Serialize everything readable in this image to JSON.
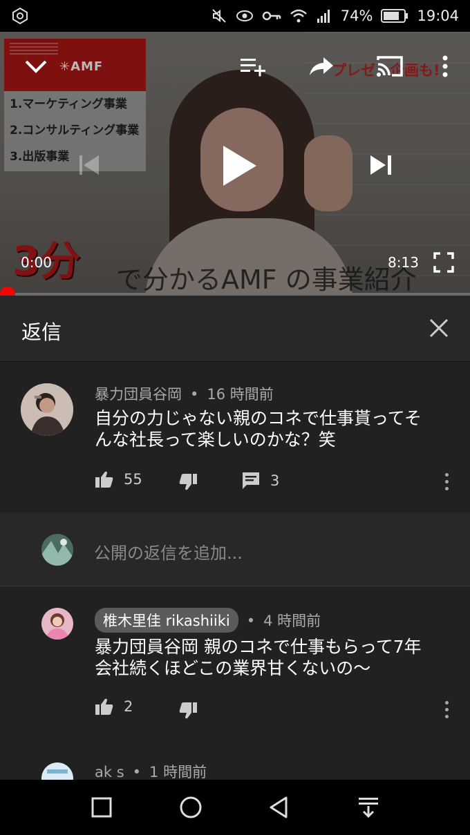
{
  "status_bar": {
    "battery": "74%",
    "time": "19:04",
    "icons": [
      "app-sync-icon",
      "mute-icon",
      "eye-icon",
      "key-icon",
      "wifi-icon",
      "signal-icon",
      "battery-icon"
    ]
  },
  "video": {
    "brand": "✳AMF",
    "menu_items": [
      "1.マーケティング事業",
      "2.コンサルティング事業",
      "3.出版事業"
    ],
    "overlay_red_text": "プレゼ　企画も!",
    "caption_big": "3分",
    "caption_rest": "で分かるAMF の事業紹介",
    "current_time": "0:00",
    "duration": "8:13",
    "progress_fraction": 0.0,
    "controls": [
      "collapse-icon",
      "add-to-queue-icon",
      "share-icon",
      "cast-icon",
      "more-icon",
      "previous-icon",
      "play-icon",
      "next-icon",
      "fullscreen-icon"
    ]
  },
  "replies_panel": {
    "title": "返信",
    "close_icon": "close-icon"
  },
  "main_comment": {
    "author": "暴力団員谷岡",
    "time_ago": "16 時間前",
    "text_line1": "自分の力じゃない親のコネで仕事貰ってそ",
    "text_line2": "んな社長って楽しいのかな？笑",
    "likes": "55",
    "replies": "3"
  },
  "reply_input": {
    "placeholder": "公開の返信を追加..."
  },
  "replies": [
    {
      "author": "椎木里佳 rikashiiki",
      "time_ago": "4 時間前",
      "text_line1": "暴力団員谷岡 親のコネで仕事もらって7年",
      "text_line2": "会社続くほどこの業界甘くないの〜",
      "likes": "2"
    },
    {
      "author": "ak s",
      "time_ago": "1 時間前"
    }
  ],
  "separator_dot": "•",
  "colors": {
    "accent_red": "#ff0000",
    "panel_bg": "#212121",
    "header_bg": "#282828"
  }
}
